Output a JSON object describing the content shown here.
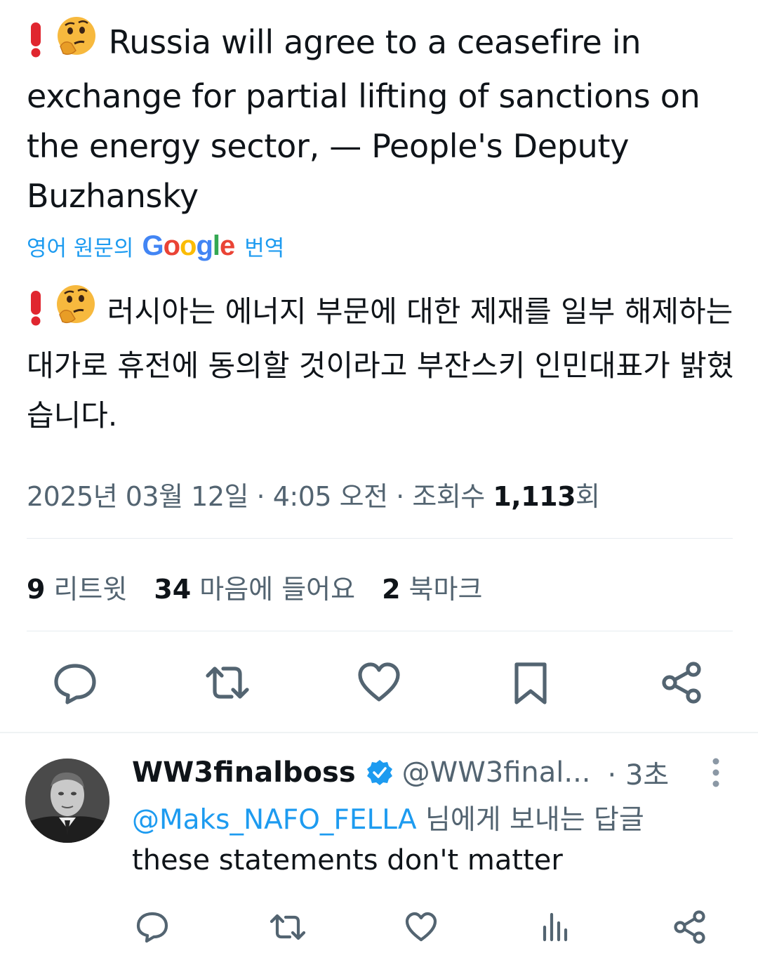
{
  "tweet": {
    "text_en": "Russia will agree to a ceasefire in exchange for partial lifting of sanctions on the energy sector, — People's Deputy Buzhansky",
    "translate": {
      "prefix": "영어 원문의",
      "google": "Google",
      "suffix": "번역"
    },
    "text_ko": "러시아는 에너지 부문에 대한 제재를 일부 해제하는 대가로 휴전에 동의할 것이라고 부잔스키 인민대표가 밝혔습니다.",
    "date": "2025년 03월 12일",
    "sep": "·",
    "time": "4:05 오전",
    "views_label": "조회수",
    "views_count": "1,113",
    "views_suffix": "회",
    "stats": {
      "retweets_count": "9",
      "retweets_label": "리트윗",
      "likes_count": "34",
      "likes_label": "마음에 들어요",
      "bookmarks_count": "2",
      "bookmarks_label": "북마크"
    }
  },
  "reply": {
    "display_name": "WW3finalboss",
    "handle": "@WW3final...",
    "time": "· 3초",
    "reply_to_mention": "@Maks_NAFO_FELLA",
    "reply_to_suffix": "님에게 보내는 답글",
    "text": "these statements don't matter"
  },
  "icons": {
    "main_actions": [
      "reply-icon",
      "retweet-icon",
      "like-icon",
      "bookmark-icon",
      "share-icon"
    ],
    "reply_actions": [
      "reply-icon",
      "retweet-icon",
      "like-icon",
      "views-icon",
      "share-icon"
    ],
    "emojis": [
      "exclamation-emoji",
      "thinking-face-emoji"
    ]
  },
  "colors": {
    "link": "#1d9bf0",
    "text": "#0f1419",
    "secondary": "#536471",
    "verified": "#1d9bf0",
    "emoji_red": "#e0262f",
    "emoji_yellow": "#f7b93e"
  }
}
